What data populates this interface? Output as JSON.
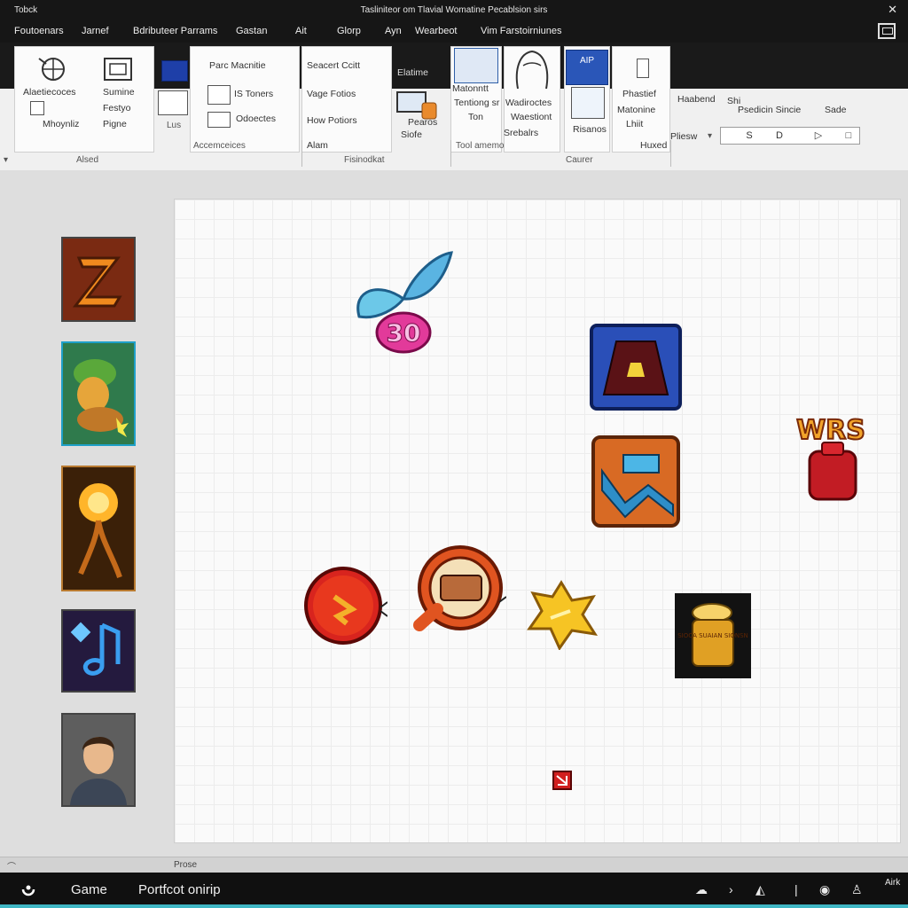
{
  "titlebar": {
    "app_name": "Tobck",
    "title": "Tasliniteor om Tlavial Womatine Pecablsion sirs",
    "close_glyph": "✕"
  },
  "tabs": [
    "Foutoenars",
    "Jarnef",
    "Bdributeer Parrams",
    "Gastan",
    "Ait",
    "Glorp",
    "Ayn",
    "Wearbeot",
    "Vim Farstoirniunes"
  ],
  "ribbon": {
    "group1": {
      "items": [
        "Alaetiecoces",
        "Sumine",
        "Festyo",
        "Mhoynliz",
        "Pigne"
      ],
      "caption": "Alsed"
    },
    "group2": {
      "items": [
        "Parc Macnitie",
        "IS Toners",
        "Odoectes"
      ],
      "footer": "Accemceices",
      "caption_left": "Lus"
    },
    "group3": {
      "items": [
        "Seacert Ccitt",
        "Vage Fotios",
        "How Potiors",
        "Alam"
      ],
      "caption": "Fisinodkat"
    },
    "group4": {
      "items": [
        "Elatime",
        "Pearos",
        "Siofe"
      ]
    },
    "group5": {
      "items": [
        "Matonntt",
        "Tentiong sr",
        "Ton",
        "Tool amemon"
      ],
      "badge": "AIP"
    },
    "group6": {
      "items": [
        "Wadiroctes",
        "Waestiont",
        "Srebalrs",
        "Risanos"
      ],
      "caption": "Caurer"
    },
    "group7": {
      "items": [
        "Phastief",
        "Matonine",
        "Lhiit",
        "Huxed"
      ]
    },
    "group8": {
      "items": [
        "Haabend",
        "Shi",
        "Psedicin Sincie",
        "Sade",
        "Pliesw"
      ]
    },
    "preview_buttons": [
      "S",
      "D",
      "▷",
      "□"
    ]
  },
  "thumbnails": [
    {
      "name": "z-emblem",
      "color": "#8a3a1c"
    },
    {
      "name": "monkey-character",
      "color": "#2c7d7a"
    },
    {
      "name": "fire-tree",
      "color": "#6a3a14"
    },
    {
      "name": "music-note",
      "color": "#241a3e"
    },
    {
      "name": "man-portrait",
      "color": "#4c4c4c"
    }
  ],
  "sprites": {
    "butterfly_text": "30",
    "badge_text": "WRS",
    "jar_text": "SIOCA SUAIAN SIONSN"
  },
  "statusbar": {
    "text": "Prose",
    "mark": "⌒"
  },
  "taskbar": {
    "app": "Game",
    "doc": "Portfcot onirip",
    "clock": "Airk"
  },
  "colors": {
    "accent": "#3fb6c4",
    "titlebar": "#161616"
  }
}
